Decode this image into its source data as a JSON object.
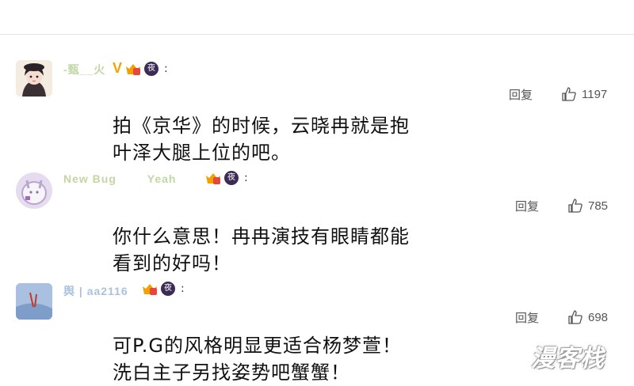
{
  "comments": [
    {
      "username": "-甄__火",
      "username_color": "#b9d09a",
      "verified": "V",
      "level_badge": "3",
      "night_badge": "夜",
      "colon": ":",
      "reply_label": "回复",
      "like_count": "1197",
      "text_lines": [
        "拍《京华》的时候，云晓冉就是抱",
        "叶泽大腿上位的吧。"
      ]
    },
    {
      "username": "New Bug        Yeah",
      "username_color": "#b6d192",
      "level_badge": "3",
      "night_badge": "夜",
      "colon": ":",
      "reply_label": "回复",
      "like_count": "785",
      "text_lines": [
        "你什么意思！冉冉演技有眼睛都能",
        "看到的好吗！"
      ]
    },
    {
      "username": "舆 | aa2116",
      "username_color": "#9cb8d8",
      "level_badge": "3",
      "night_badge": "夜",
      "colon": ":",
      "reply_label": "回复",
      "like_count": "698",
      "text_lines": [
        "可P.G的风格明显更适合杨梦萱！",
        "洗白主子另找姿势吧蟹蟹！"
      ]
    }
  ],
  "watermark": "漫客栈",
  "icons": {
    "like": "thumbs-up-icon",
    "level": "crown-level-icon",
    "night": "night-badge-icon"
  }
}
